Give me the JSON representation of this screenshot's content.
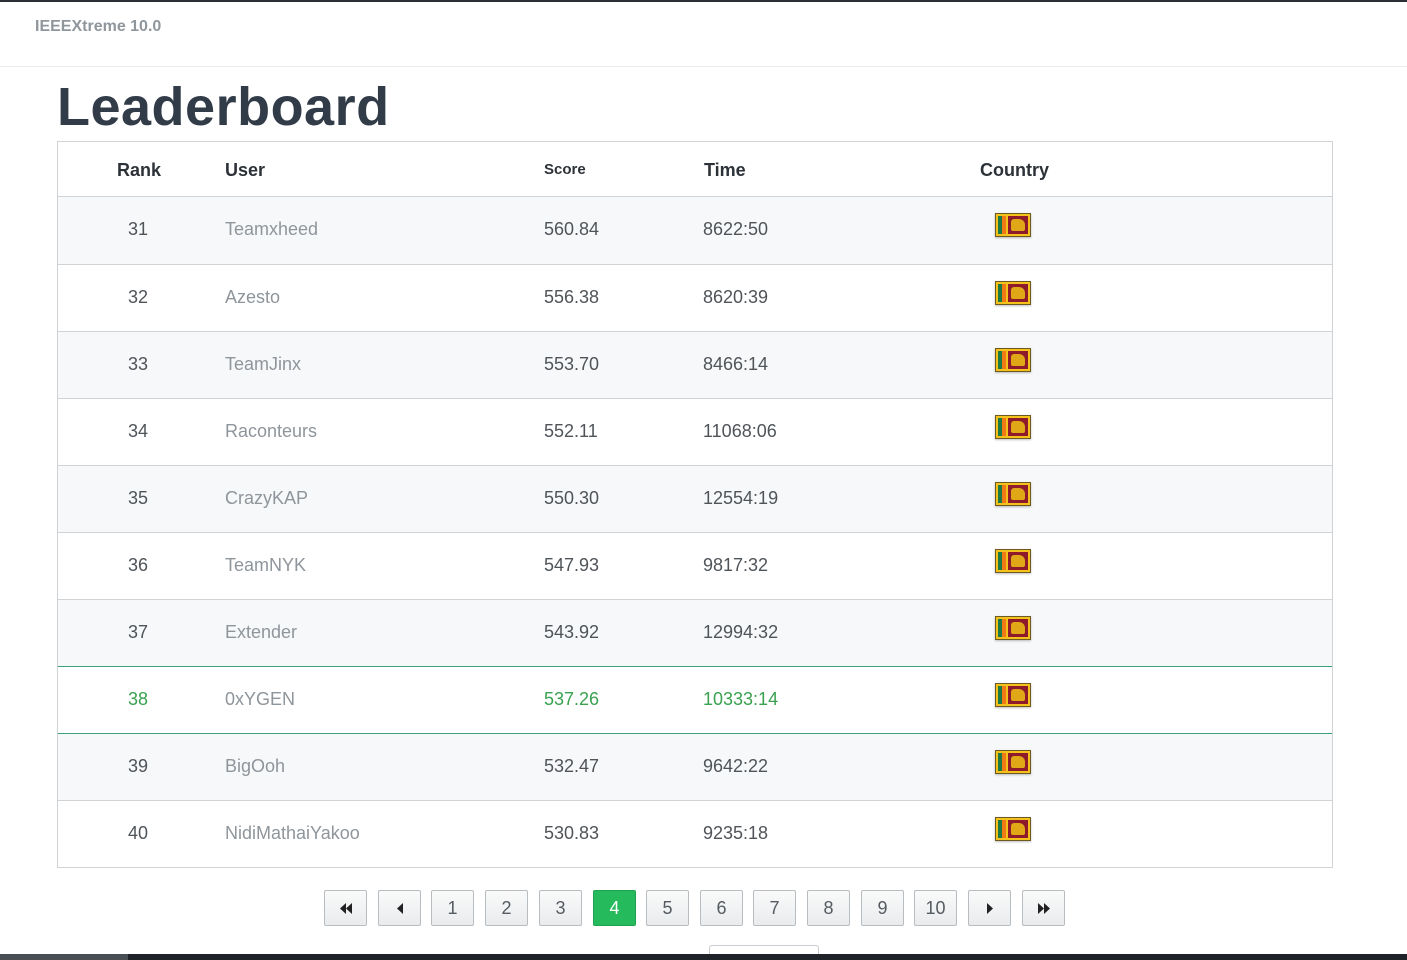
{
  "brand": "IEEEXtreme 10.0",
  "page_title": "Leaderboard",
  "columns": {
    "rank": "Rank",
    "user": "User",
    "score": "Score",
    "time": "Time",
    "country": "Country"
  },
  "rows": [
    {
      "rank": "31",
      "user": "Teamxheed",
      "score": "560.84",
      "time": "8622:50",
      "country_icon": "sri-lanka-flag-icon"
    },
    {
      "rank": "32",
      "user": "Azesto",
      "score": "556.38",
      "time": "8620:39",
      "country_icon": "sri-lanka-flag-icon"
    },
    {
      "rank": "33",
      "user": "TeamJinx",
      "score": "553.70",
      "time": "8466:14",
      "country_icon": "sri-lanka-flag-icon"
    },
    {
      "rank": "34",
      "user": "Raconteurs",
      "score": "552.11",
      "time": "11068:06",
      "country_icon": "sri-lanka-flag-icon"
    },
    {
      "rank": "35",
      "user": "CrazyKAP",
      "score": "550.30",
      "time": "12554:19",
      "country_icon": "sri-lanka-flag-icon"
    },
    {
      "rank": "36",
      "user": "TeamNYK",
      "score": "547.93",
      "time": "9817:32",
      "country_icon": "sri-lanka-flag-icon"
    },
    {
      "rank": "37",
      "user": "Extender",
      "score": "543.92",
      "time": "12994:32",
      "country_icon": "sri-lanka-flag-icon"
    },
    {
      "rank": "38",
      "user": "0xYGEN",
      "score": "537.26",
      "time": "10333:14",
      "country_icon": "sri-lanka-flag-icon",
      "highlighted": true
    },
    {
      "rank": "39",
      "user": "BigOoh",
      "score": "532.47",
      "time": "9642:22",
      "country_icon": "sri-lanka-flag-icon"
    },
    {
      "rank": "40",
      "user": "NidiMathaiYakoo",
      "score": "530.83",
      "time": "9235:18",
      "country_icon": "sri-lanka-flag-icon"
    }
  ],
  "pagination": {
    "pages": [
      "1",
      "2",
      "3",
      "4",
      "5",
      "6",
      "7",
      "8",
      "9",
      "10"
    ],
    "current": "4",
    "first_icon": "double-chevron-left-icon",
    "prev_icon": "caret-left-icon",
    "next_icon": "caret-right-icon",
    "last_icon": "double-chevron-right-icon"
  },
  "colors": {
    "highlight": "#39a14f",
    "active_page": "#25bb5c",
    "title": "#323b48"
  }
}
